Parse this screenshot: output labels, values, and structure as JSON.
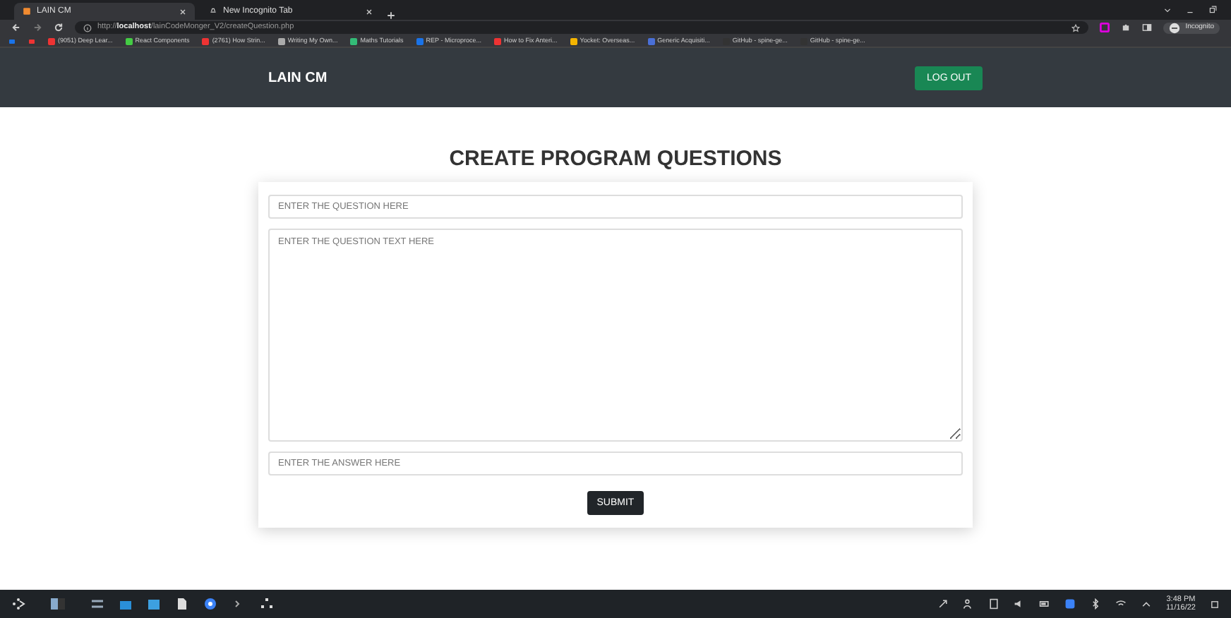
{
  "browser": {
    "tabs": [
      {
        "title": "LAIN CM",
        "selected": true
      },
      {
        "title": "New Incognito Tab",
        "selected": false
      }
    ],
    "address": {
      "scheme": "http://",
      "host": "localhost",
      "path": "/lainCodeMonger_V2/createQuestion.php"
    },
    "profile_label": "Incognito",
    "bookmarks": [
      "(9051) Deep Lear...",
      "React Components",
      "(2761) How Strin...",
      "Writing My Own...",
      "Maths Tutorials",
      "REP - Microproce...",
      "How to Fix Anteri...",
      "Yocket: Overseas...",
      "Generic Acquisiti...",
      "GitHub - spine-ge...",
      "GitHub - spine-ge..."
    ]
  },
  "navbar": {
    "brand": "LAIN CM",
    "button": "LOG OUT"
  },
  "page": {
    "heading": "CREATE PROGRAM QUESTIONS",
    "fields": [
      {
        "kind": "input",
        "placeholder": "ENTER THE QUESTION HERE"
      },
      {
        "kind": "textarea",
        "placeholder": "ENTER THE QUESTION TEXT HERE"
      },
      {
        "kind": "input",
        "placeholder": "ENTER THE ANSWER HERE"
      }
    ],
    "submit": "SUBMIT"
  },
  "taskbar": {
    "time": "3:48 PM",
    "date": "11/16/22"
  }
}
